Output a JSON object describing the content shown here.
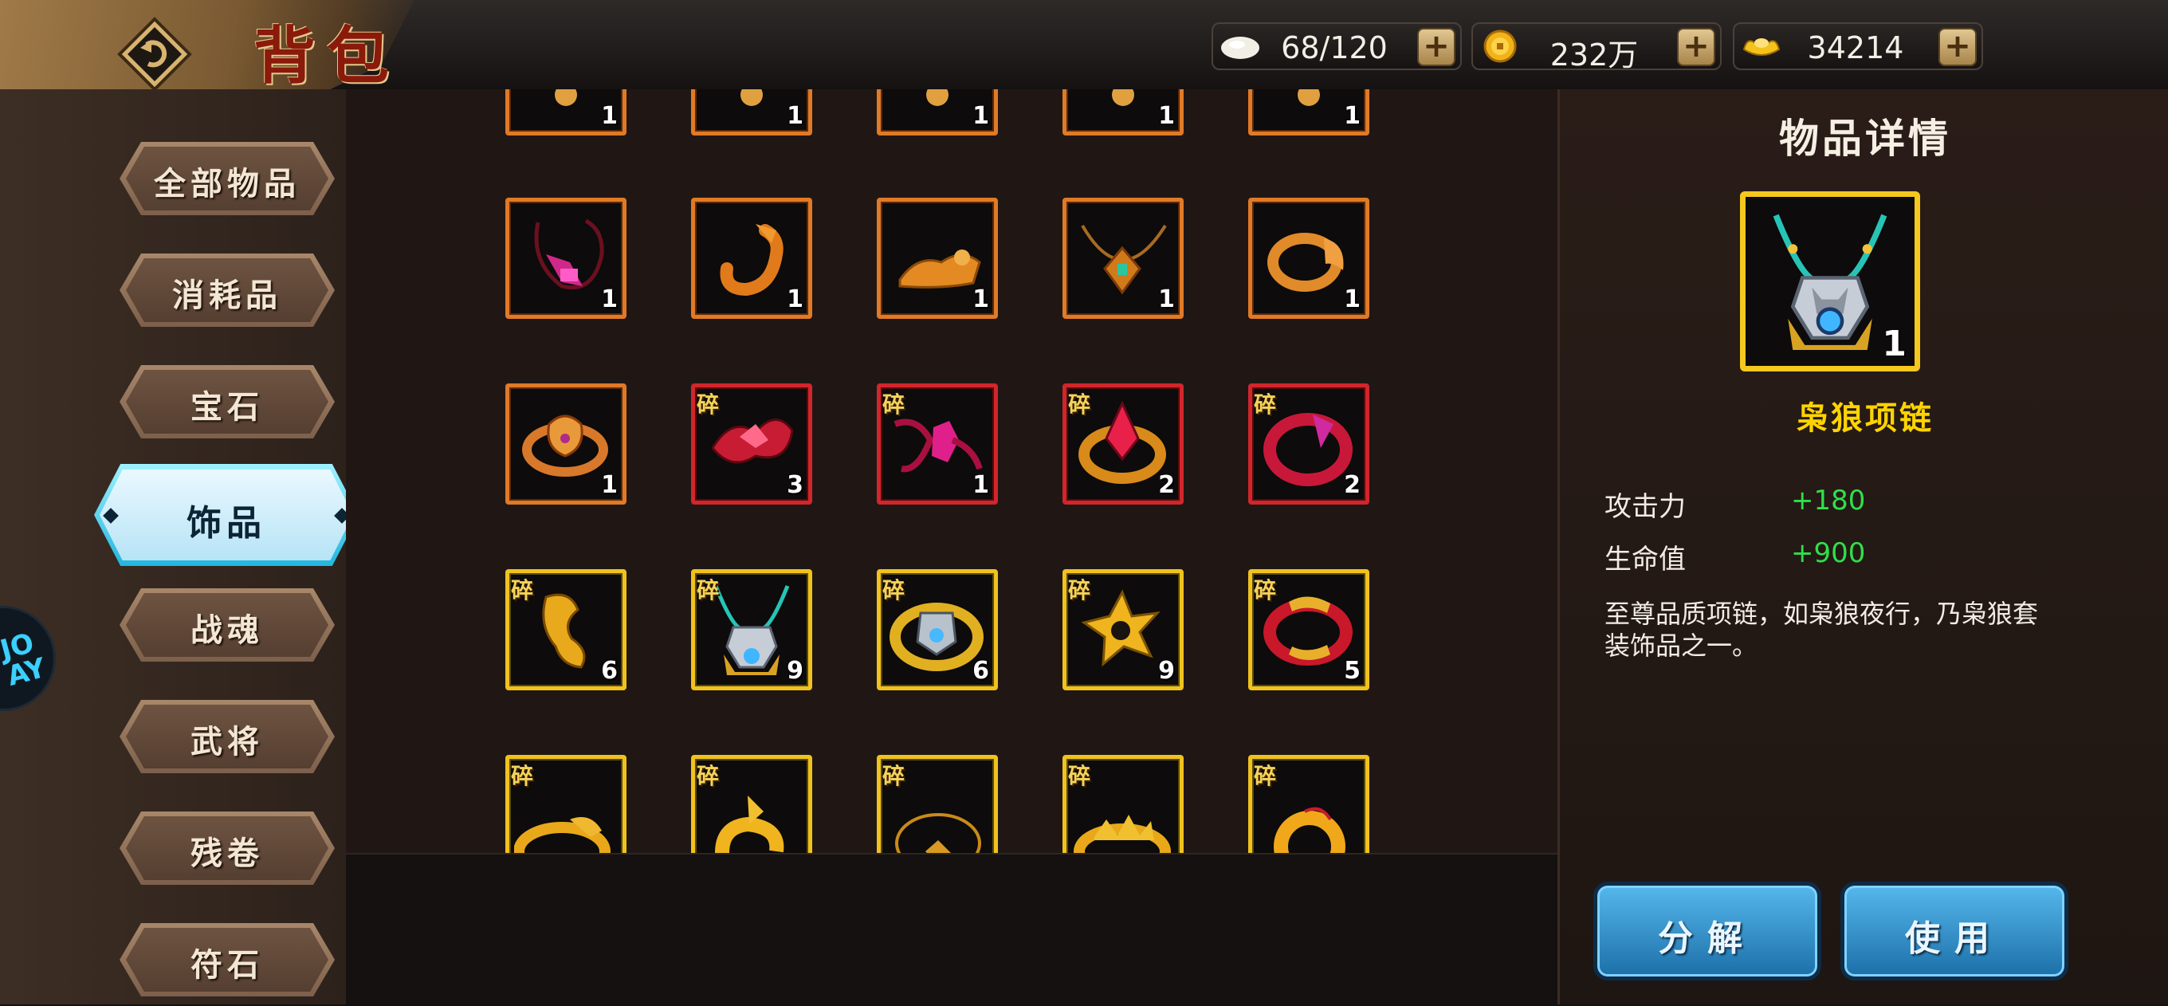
{
  "header": {
    "title": "背包",
    "resources": [
      {
        "icon": "bun-icon",
        "value": "68/120",
        "plus": "+"
      },
      {
        "icon": "gold-coin-icon",
        "value": "232万",
        "plus": "+"
      },
      {
        "icon": "gold-ingot-icon",
        "value": "34214",
        "plus": "+"
      }
    ]
  },
  "sidebar": {
    "categories": [
      {
        "label": "全部物品"
      },
      {
        "label": "消耗品"
      },
      {
        "label": "宝石"
      },
      {
        "label": "饰品",
        "active": true
      },
      {
        "label": "战魂"
      },
      {
        "label": "武将"
      },
      {
        "label": "残卷"
      },
      {
        "label": "符石"
      }
    ],
    "badge_text": "JO\nAY"
  },
  "inventory": {
    "fragment_mark": "碎",
    "rows": [
      [
        {
          "icon": "necklace-icon",
          "rarity": "orange",
          "count": "1"
        },
        {
          "icon": "necklace-icon",
          "rarity": "orange",
          "count": "1"
        },
        {
          "icon": "necklace-icon",
          "rarity": "orange",
          "count": "1"
        },
        {
          "icon": "necklace-icon",
          "rarity": "orange",
          "count": "1"
        },
        {
          "icon": "necklace-icon",
          "rarity": "orange",
          "count": "1"
        }
      ],
      [
        {
          "icon": "pink-necklace-icon",
          "rarity": "orange",
          "count": "1"
        },
        {
          "icon": "dragon-pendant-icon",
          "rarity": "orange",
          "count": "1"
        },
        {
          "icon": "beast-charm-icon",
          "rarity": "orange",
          "count": "1"
        },
        {
          "icon": "emerald-necklace-icon",
          "rarity": "orange",
          "count": "1"
        },
        {
          "icon": "dragon-ring-icon",
          "rarity": "orange",
          "count": "1"
        }
      ],
      [
        {
          "icon": "beast-ring-icon",
          "rarity": "orange",
          "count": "1"
        },
        {
          "icon": "red-charm-icon",
          "rarity": "red",
          "count": "3",
          "fragment": true
        },
        {
          "icon": "crystal-necklace-icon",
          "rarity": "red",
          "count": "1",
          "fragment": true
        },
        {
          "icon": "crystal-ring-icon",
          "rarity": "red",
          "count": "2",
          "fragment": true
        },
        {
          "icon": "red-ring-icon",
          "rarity": "red",
          "count": "2",
          "fragment": true
        }
      ],
      [
        {
          "icon": "gold-charm-icon",
          "rarity": "gold",
          "count": "6",
          "fragment": true
        },
        {
          "icon": "wolf-necklace-icon",
          "rarity": "gold",
          "count": "9",
          "fragment": true
        },
        {
          "icon": "wolf-ring-icon",
          "rarity": "gold",
          "count": "6",
          "fragment": true
        },
        {
          "icon": "flower-charm-icon",
          "rarity": "gold",
          "count": "9",
          "fragment": true
        },
        {
          "icon": "dragon-bangle-icon",
          "rarity": "gold",
          "count": "5",
          "fragment": true
        }
      ],
      [
        {
          "icon": "gold-ring-icon",
          "rarity": "gold",
          "count": "",
          "fragment": true
        },
        {
          "icon": "gold-pendant-icon",
          "rarity": "gold",
          "count": "",
          "fragment": true
        },
        {
          "icon": "gold-necklace-icon",
          "rarity": "gold",
          "count": "",
          "fragment": true
        },
        {
          "icon": "gold-crown-ring-icon",
          "rarity": "gold",
          "count": "",
          "fragment": true
        },
        {
          "icon": "gold-coil-icon",
          "rarity": "gold",
          "count": "",
          "fragment": true
        }
      ]
    ]
  },
  "detail": {
    "title": "物品详情",
    "item_icon": "wolf-necklace-icon",
    "item_count": "1",
    "item_name": "枭狼项链",
    "stats": [
      {
        "label": "攻击力",
        "value": "+180"
      },
      {
        "label": "生命值",
        "value": "+900"
      }
    ],
    "description": "至尊品质项链，如枭狼夜行，乃枭狼套装饰品之一。",
    "buttons": {
      "decompose": "分解",
      "use": "使用"
    }
  },
  "colors": {
    "rarity_orange": "#e07a26",
    "rarity_red": "#d0262c",
    "rarity_gold": "#f0c21e",
    "item_name": "#ffd400",
    "stat_value": "#2fe04a",
    "active_tab": "#22b6df"
  }
}
